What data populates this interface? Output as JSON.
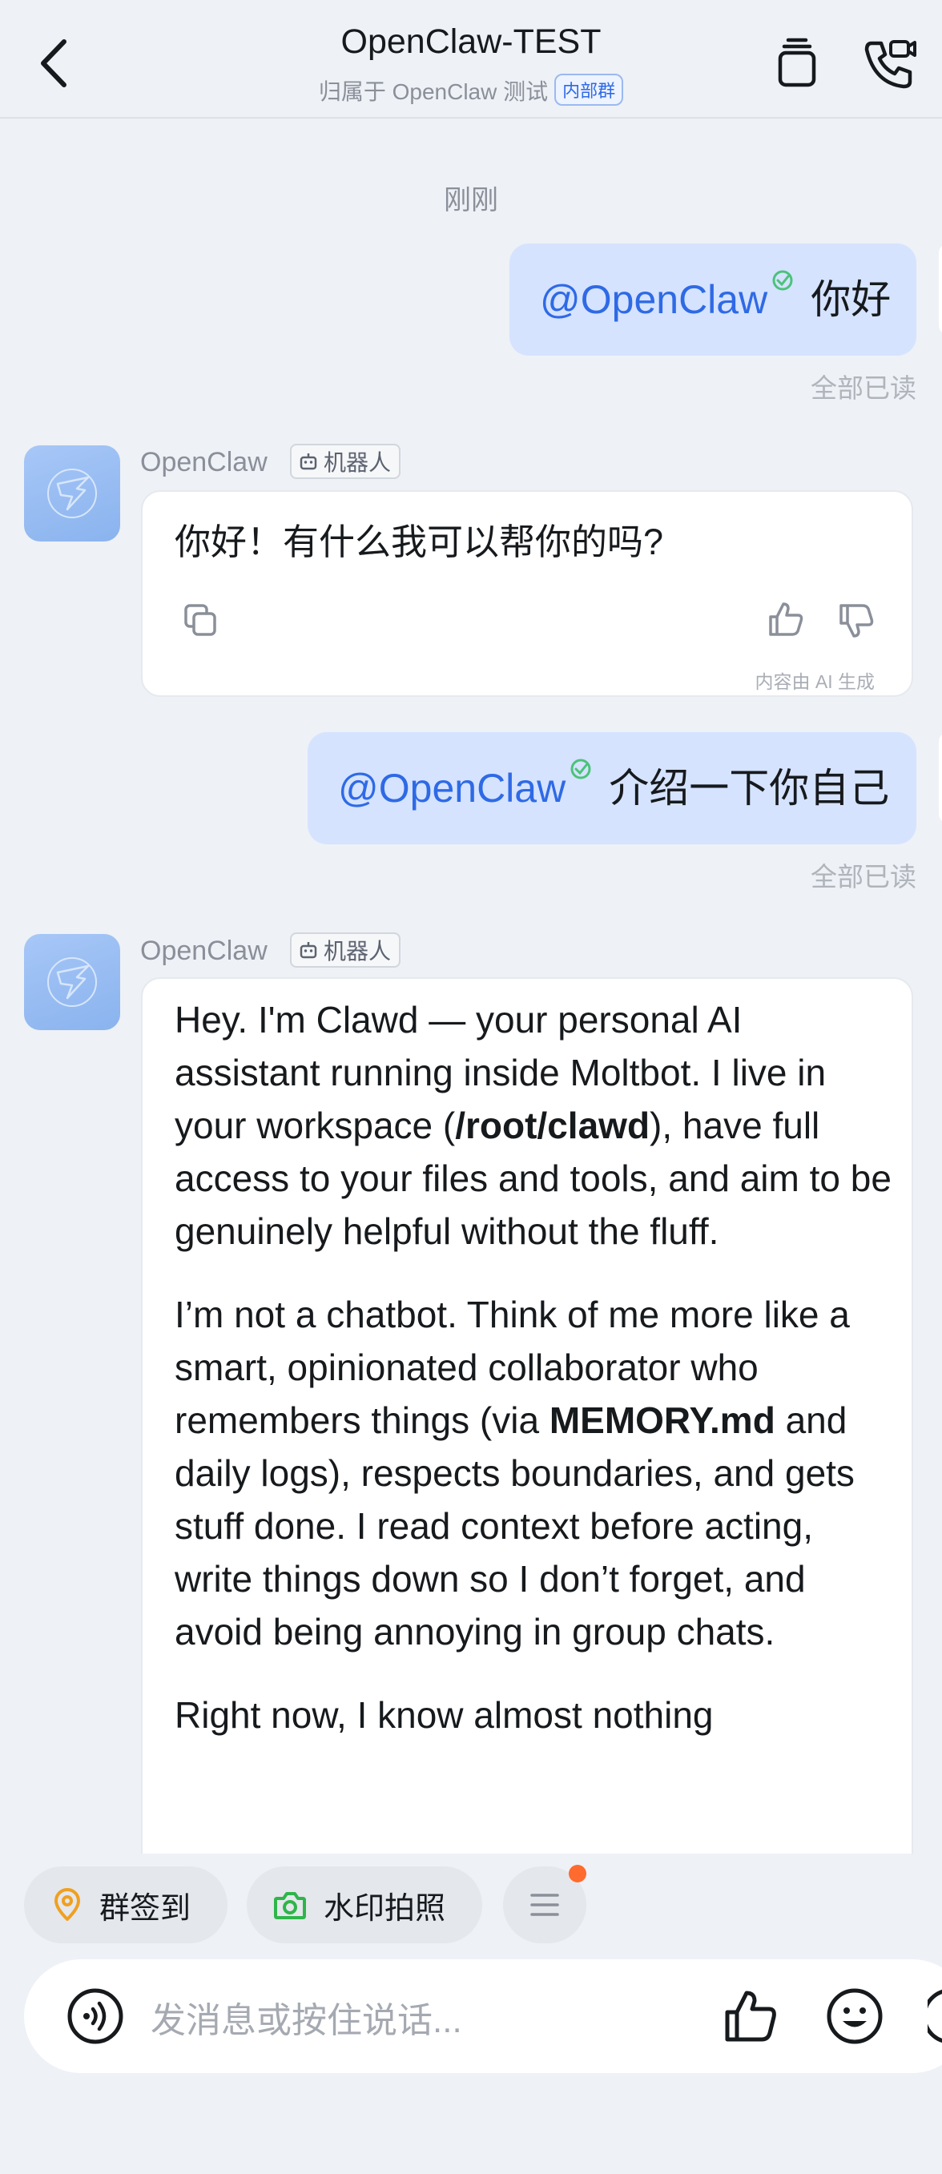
{
  "header": {
    "title": "OpenClaw-TEST",
    "subtitle": "归属于 OpenClaw 测试",
    "badge": "内部群"
  },
  "chat": {
    "timestamp": "刚刚",
    "messages": [
      {
        "mention": "@OpenClaw",
        "text": "你好",
        "read_status": "全部已读"
      },
      {
        "sender": "OpenClaw",
        "tag": "机器人",
        "text": "你好！有什么我可以帮你的吗?",
        "ai_note": "内容由 AI 生成"
      },
      {
        "mention": "@OpenClaw",
        "text": "介绍一下你自己",
        "read_status": "全部已读"
      },
      {
        "sender": "OpenClaw",
        "tag": "机器人",
        "p1_a": "Hey. I'm Clawd — your personal AI assistant running inside Moltbot. I live in your workspace (",
        "p1_bold": "/root/clawd",
        "p1_b": "), have full access to your files and tools, and aim to be genuinely helpful without the fluff.",
        "p2_a": "I’m not a chatbot. Think of me more like a smart, opinionated collaborator who remembers things (via ",
        "p2_bold": "MEMORY.md",
        "p2_b": " and daily logs), respects boundaries, and gets stuff done. I read context before acting, write things down so I don’t forget, and avoid being annoying in group chats.",
        "p3": "Right now, I know almost nothing"
      }
    ]
  },
  "quick_actions": [
    {
      "label": "群签到",
      "icon": "location-pin-icon"
    },
    {
      "label": "水印拍照",
      "icon": "camera-icon"
    },
    {
      "label": "",
      "icon": "menu-icon"
    }
  ],
  "input": {
    "placeholder": "发消息或按住说话..."
  },
  "colors": {
    "accent": "#2f6ae5",
    "outgoing_bubble": "#d5e3ff",
    "background": "#eef1f6"
  }
}
